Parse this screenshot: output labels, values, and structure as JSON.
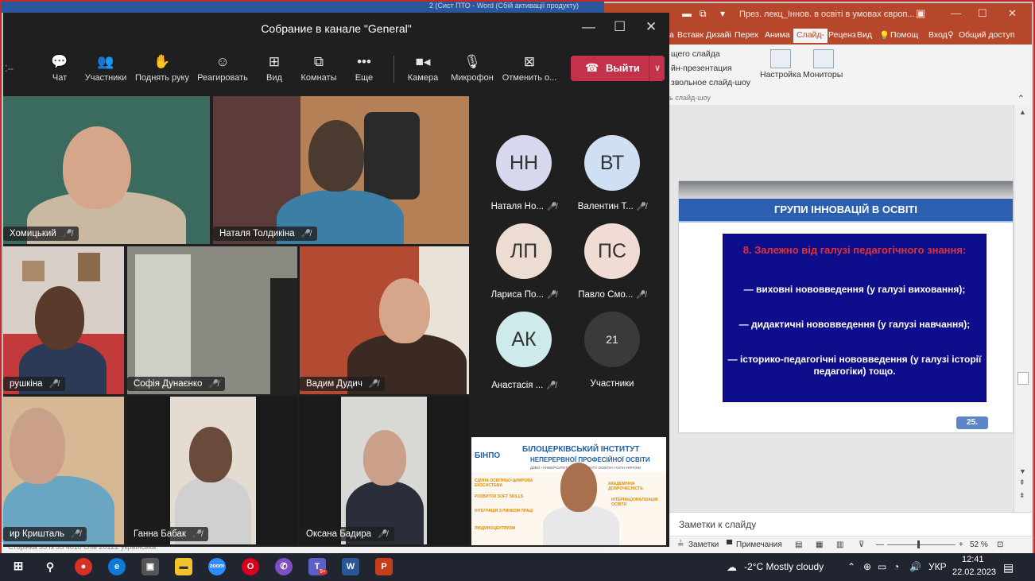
{
  "word": {
    "title_fragment": "2 (Сист ПТО - Word (Сбій активації продукту)",
    "status_fragment": "Сторінка 35 із 35    4010 слів 20122    українська"
  },
  "ppt": {
    "title": "През. лекц_Іннов. в освіті в умовах європ...",
    "tabs": [
      "а",
      "Вставк",
      "Дизайі",
      "Перех",
      "Анима",
      "Слайд-",
      "Реценз",
      "Вид",
      "Помощ",
      "Вход",
      "Общий доступ"
    ],
    "active_tab_index": 5,
    "ribbon": {
      "line1": "щего слайда",
      "line2": "йн-презентация",
      "line3": "звольное слайд-шоу",
      "group": "ь слайд-шоу",
      "settings": "Настройка",
      "monitors": "Мониторы"
    },
    "slide": {
      "title": "ГРУПИ ІННОВАЦІЙ В ОСВІТІ",
      "heading": "8. Залежно від галузі педагогічного знання:",
      "bullets": [
        "— виховні нововведення (у галузі виховання);",
        "— дидактичні нововведення (у галузі навчання);",
        "— історико-педагогічні нововведення (у галузі історії педагогіки) тощо."
      ],
      "number": "25."
    },
    "notes": "Заметки к слайду",
    "status": {
      "notes": "Заметки",
      "comments": "Примечания",
      "zoom": "52 %"
    }
  },
  "teams": {
    "meeting_title": "Собрание в канале \"General\"",
    "toolbar": {
      "chat": "Чат",
      "participants": "Участники",
      "raise_hand": "Поднять руку",
      "react": "Реагировать",
      "view": "Вид",
      "rooms": "Комнаты",
      "more": "Еще",
      "camera": "Камера",
      "microphone": "Микрофон",
      "cancel": "Отменить о...",
      "leave": "Выйти"
    },
    "video_tiles": [
      {
        "name": "Хомицький"
      },
      {
        "name": "Наталя Толдикіна"
      },
      {
        "name": "рушкіна"
      },
      {
        "name": "Софія Дунаєнко"
      },
      {
        "name": "Вадим Дудич"
      },
      {
        "name": "ир Кришталь"
      },
      {
        "name": "Ганна Бабак"
      },
      {
        "name": "Оксана Бадира"
      }
    ],
    "avatars": [
      {
        "initials": "НН",
        "name": "Наталя Но...",
        "color": "#d6d8ee"
      },
      {
        "initials": "ВТ",
        "name": "Валентин Т...",
        "color": "#cfe0f2"
      },
      {
        "initials": "ЛП",
        "name": "Лариса По...",
        "color": "#eddcd2"
      },
      {
        "initials": "ПС",
        "name": "Павло Смо...",
        "color": "#f0dcd5"
      },
      {
        "initials": "АК",
        "name": "Анастасія ...",
        "color": "#cfeaea"
      }
    ],
    "participants_count": "21",
    "participants_label": "Участники",
    "presenter_banner": {
      "logo": "БІНПО",
      "line1": "БІЛОЦЕРКІВСЬКИЙ ІНСТИТУТ",
      "line2": "НЕПЕРЕРВНОЇ ПРОФЕСІЙНОЇ ОСВІТИ",
      "line3": "ДЗВО «УНІВЕРСИТЕТ МЕНЕДЖМЕНТУ ОСВІТИ» НАПН УКРАЇНИ",
      "left_items": [
        "ЄДИНА ОСВІТНЬО-ЦИФРОВА ЕКОСИСТЕМА",
        "РОЗВИТОК SOFT SKILLS",
        "ІНТЕГРАЦІЯ З РИНКОМ ПРАЦІ",
        "ЛЮДИНОЦЕНТРИЗМ"
      ],
      "right_items": [
        "АКАДЕМІЧНА ДОБРОЧЕСНІСТЬ",
        "ІНТЕРНАЦІОНАЛІЗАЦІЯ ОСВІТИ"
      ]
    }
  },
  "taskbar": {
    "weather": "-2°C  Mostly cloudy",
    "lang": "УКР",
    "time": "12:41",
    "date": "22.02.2023",
    "teams_badge": "9+"
  }
}
